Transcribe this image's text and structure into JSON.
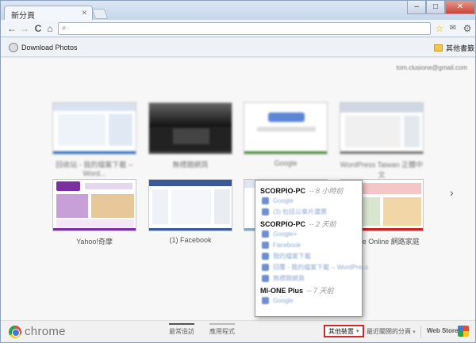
{
  "window": {
    "tab_title": "新分頁",
    "controls": {
      "minimize": "–",
      "maximize": "□",
      "close": "✕"
    }
  },
  "toolbar": {
    "back": "←",
    "forward": "→",
    "reload": "C",
    "home": "⌂",
    "omnibox_value": ""
  },
  "bookmarks": {
    "download_photos": "Download Photos",
    "other_bookmarks": "其他書籤"
  },
  "account_email": "tom.clusione@gmail.com",
  "thumbnails_row1": [
    {
      "caption": "回收站 - 我的檔案下載 -- Word..."
    },
    {
      "caption": "無標題網頁"
    },
    {
      "caption": "Google"
    },
    {
      "caption": "WordPress Taiwan 正體中文"
    }
  ],
  "thumbnails_row2": [
    {
      "caption": "Yahoo!奇摩"
    },
    {
      "caption": "(1) Facebook"
    },
    {
      "caption": ""
    },
    {
      "caption": "me Online 網路家庭"
    }
  ],
  "next_page_arrow": "›",
  "other_devices_menu": {
    "sessions": [
      {
        "device": "SCORPIO-PC",
        "ago": "-- 8 小時前",
        "items": [
          "Google",
          "(3) 包括公車片還票"
        ]
      },
      {
        "device": "SCORPIO-PC",
        "ago": "-- 2 天前",
        "items": [
          "Google+",
          "Facebook",
          "我的檔案下載",
          "回覆 - 我的檔案下載 -- WordPress",
          "無標題網頁"
        ]
      },
      {
        "device": "MI-ONE Plus",
        "ago": "-- 7 天前",
        "items": [
          "Google"
        ]
      }
    ]
  },
  "bottom": {
    "logo_text": "chrome",
    "tab_most_visited": "最常造訪",
    "tab_apps": "應用程式",
    "other_devices": "其他裝置",
    "recently_closed": "最近關閉的分頁",
    "web_store": "Web Store"
  }
}
